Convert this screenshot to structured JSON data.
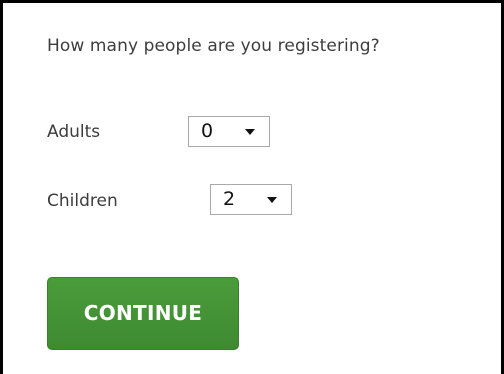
{
  "form": {
    "question": "How many people are you registering?",
    "adults": {
      "label": "Adults",
      "selected_value": "0"
    },
    "children": {
      "label": "Children",
      "selected_value": "2"
    },
    "continue_label": "CONTINUE"
  },
  "colors": {
    "button_green": "#4a9c3a",
    "button_text": "#ffffff",
    "label_text": "#3d3d3d",
    "frame_border": "#000000"
  },
  "icons": {
    "select_arrow": "caret-down-icon"
  }
}
